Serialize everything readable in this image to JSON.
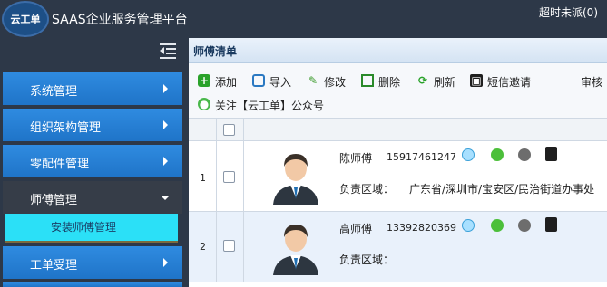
{
  "header": {
    "logo_text": "云工单",
    "app_title": "SAAS企业服务管理平台",
    "pending_notice": "超时未派(0)"
  },
  "sidebar": {
    "items": [
      {
        "label": "系统管理"
      },
      {
        "label": "组织架构管理"
      },
      {
        "label": "零配件管理"
      },
      {
        "label": "师傅管理",
        "expanded": true
      },
      {
        "label": "工单受理"
      }
    ],
    "submenu": {
      "label": "安装师傅管理"
    }
  },
  "panel": {
    "title": "师傅清单"
  },
  "toolbar": {
    "add": "添加",
    "import": "导入",
    "edit": "修改",
    "delete": "删除",
    "refresh": "刷新",
    "sms_invite": "短信邀请",
    "audit": "审核",
    "follow": "关注【云工单】公众号"
  },
  "table": {
    "rows": [
      {
        "index": "1",
        "name": "陈师傅",
        "phone": "15917461247",
        "area_label": "负责区域：",
        "area": "广东省/深圳市/宝安区/民治街道办事处"
      },
      {
        "index": "2",
        "name": "高师傅",
        "phone": "13392820369",
        "area_label": "负责区域：",
        "area": ""
      }
    ]
  },
  "colors": {
    "sidebar_bg": "#2d3848",
    "menu_blue": "#2f8be0",
    "submenu_active": "#2be0f7",
    "alt_row": "#e9f1fb"
  }
}
